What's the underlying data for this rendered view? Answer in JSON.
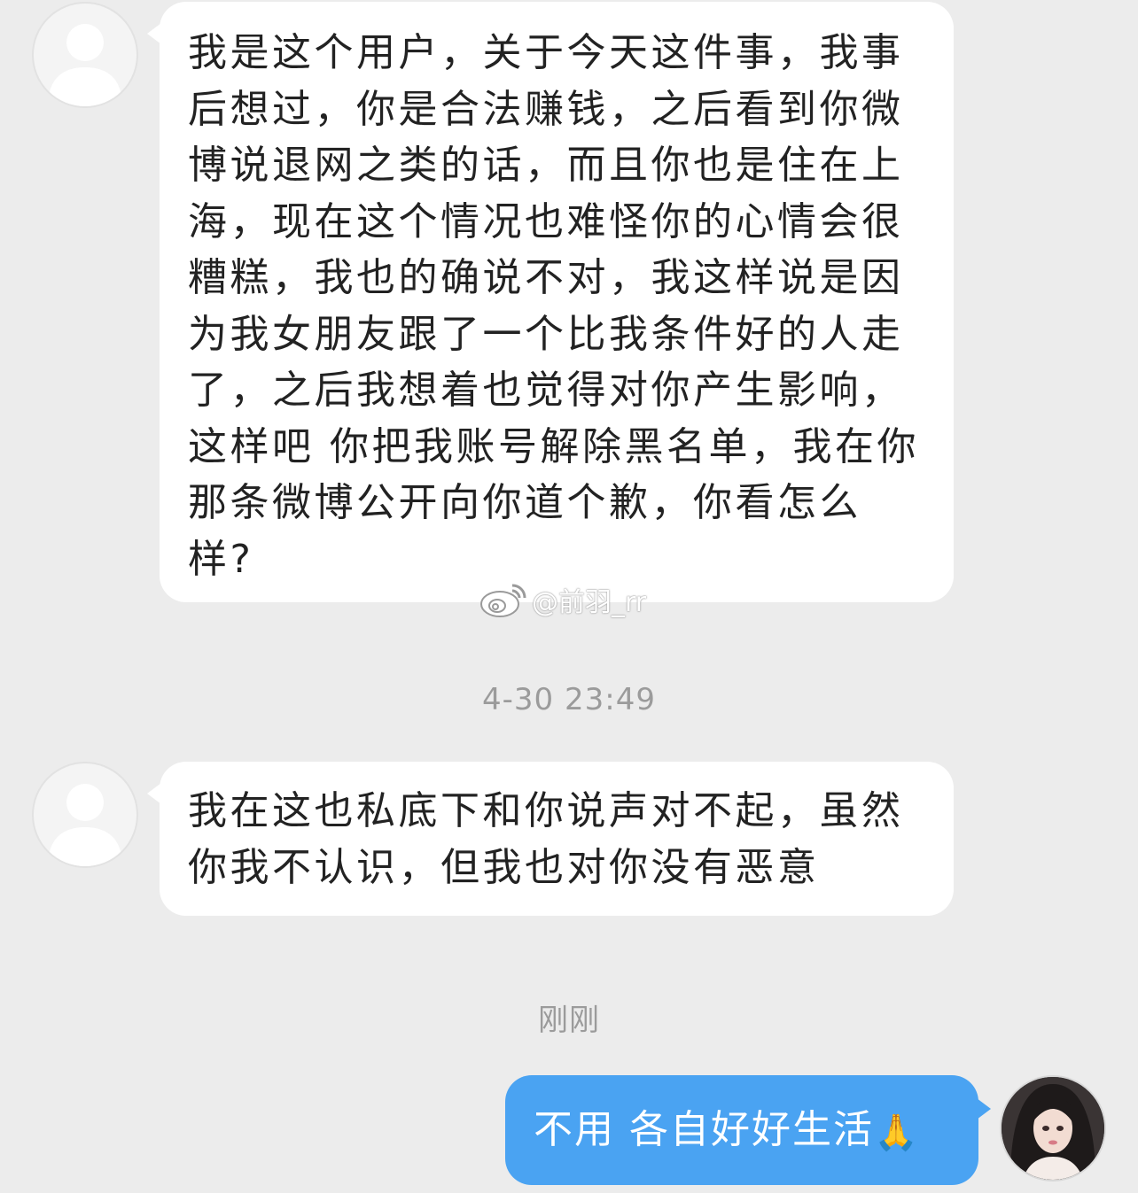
{
  "conversation": {
    "messages": [
      {
        "direction": "incoming",
        "text": "我是这个用户，关于今天这件事，我事后想过，你是合法赚钱，之后看到你微博说退网之类的话，而且你也是住在上海，现在这个情况也难怪你的心情会很糟糕，我也的确说不对，我这样说是因为我女朋友跟了一个比我条件好的人走了，之后我想着也觉得对你产生影响，这样吧 你把我账号解除黑名单，我在你那条微博公开向你道个歉，你看怎么样?"
      },
      {
        "direction": "incoming",
        "text": "我在这也私底下和你说声对不起，虽然你我不认识，但我也对你没有恶意"
      },
      {
        "direction": "outgoing",
        "text": "不用 各自好好生活",
        "emoji": "🙏"
      }
    ],
    "timestamps": [
      "4-30 23:49",
      "刚刚"
    ]
  },
  "watermark": {
    "text": "@前羽_rr",
    "icon": "weibo-logo-icon"
  },
  "colors": {
    "background": "#ececec",
    "incoming_bubble": "#ffffff",
    "outgoing_bubble": "#4aa3f2",
    "timestamp": "#9b9b9b"
  }
}
